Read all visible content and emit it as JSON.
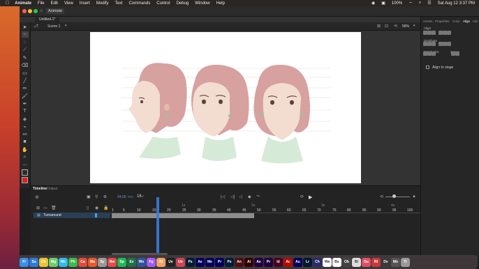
{
  "menubar": {
    "apple": "",
    "items": [
      "Animate",
      "File",
      "Edit",
      "View",
      "Insert",
      "Modify",
      "Text",
      "Commands",
      "Control",
      "Debug",
      "Window",
      "Help"
    ],
    "battery": "100%",
    "datetime": "Sat Aug 12  3:37 PM"
  },
  "titlebar": {
    "app_name": "Animate"
  },
  "document": {
    "tab": "Untitled-1*"
  },
  "scenebar": {
    "scene": "Scene 1",
    "zoom": "56%"
  },
  "panel": {
    "tabs": [
      "Assets",
      "Properties",
      "Color",
      "Align",
      "Libr"
    ],
    "active_tab": "Align",
    "sections": {
      "align": "Align",
      "distribute": "Distribute",
      "match_size": "Match size",
      "space": "Space"
    },
    "align_to_stage": "Align to stage"
  },
  "timeline": {
    "tabs": [
      "Timeline",
      "Output"
    ],
    "fps": "24.00",
    "fps_unit": "FPS",
    "frame": "16",
    "frame_suffix": "F",
    "layer_name": "Turnaround",
    "ruler": [
      "1",
      "5",
      "10",
      "15",
      "20",
      "25",
      "30",
      "35",
      "40",
      "45",
      "50",
      "55",
      "60",
      "65",
      "70",
      "75",
      "80",
      "85",
      "90",
      "95",
      "100"
    ],
    "ruler_seconds": [
      "1s",
      "2s",
      "3s",
      "4s"
    ]
  },
  "dock": {
    "apps": [
      {
        "label": "Fi",
        "color": "#3a8ee6"
      },
      {
        "label": "Sa",
        "color": "#2a7be0"
      },
      {
        "label": "Ch",
        "color": "#e7c533"
      },
      {
        "label": "Mg",
        "color": "#6ad06a"
      },
      {
        "label": "Ms",
        "color": "#30b9ea"
      },
      {
        "label": "Ph",
        "color": "#3fb84e"
      },
      {
        "label": "Ca",
        "color": "#e04a3a"
      },
      {
        "label": "Ma",
        "color": "#e85a2a"
      },
      {
        "label": "Sy",
        "color": "#999999"
      },
      {
        "label": "Nw",
        "color": "#e54b4b"
      },
      {
        "label": "Sp",
        "color": "#1db954"
      },
      {
        "label": "Ex",
        "color": "#1e7145"
      },
      {
        "label": "Wo",
        "color": "#2b579a"
      },
      {
        "label": "Fg",
        "color": "#a259ff"
      },
      {
        "label": "Bl",
        "color": "#f4a261"
      },
      {
        "label": "Ue",
        "color": "#222222"
      },
      {
        "label": "Un",
        "color": "#cc4455"
      },
      {
        "label": "Ps",
        "color": "#001e36"
      },
      {
        "label": "Ae",
        "color": "#00005b"
      },
      {
        "label": "Me",
        "color": "#00005b"
      },
      {
        "label": "Pr",
        "color": "#00005b"
      },
      {
        "label": "Ps",
        "color": "#001e36"
      },
      {
        "label": "An",
        "color": "#4a1010"
      },
      {
        "label": "Ai",
        "color": "#330000"
      },
      {
        "label": "Ae",
        "color": "#1f0040"
      },
      {
        "label": "Pr",
        "color": "#1f0040"
      },
      {
        "label": "Id",
        "color": "#49021f"
      },
      {
        "label": "Ac",
        "color": "#b30b00"
      },
      {
        "label": "Au",
        "color": "#00005b"
      },
      {
        "label": "Lr",
        "color": "#001a2e"
      },
      {
        "label": "Ch",
        "color": "#2b2b6b"
      },
      {
        "label": "Wa",
        "color": "#ffffff"
      },
      {
        "label": "Bs",
        "color": "#ffffff"
      },
      {
        "label": "Ob",
        "color": "#444444"
      },
      {
        "label": "Bl",
        "color": "#dddddd"
      },
      {
        "label": "Du",
        "color": "#e05060"
      },
      {
        "label": "Rt",
        "color": "#c63a3a"
      },
      {
        "label": "Dv",
        "color": "#3a3a3a"
      },
      {
        "label": "Mn",
        "color": "#555555"
      },
      {
        "label": "Tr",
        "color": "#999999"
      }
    ]
  },
  "colors": {
    "accent": "#2f86c9",
    "stage": "#ffffff",
    "playhead": "#3a7be0",
    "layer_selected": "#2a3f56"
  }
}
